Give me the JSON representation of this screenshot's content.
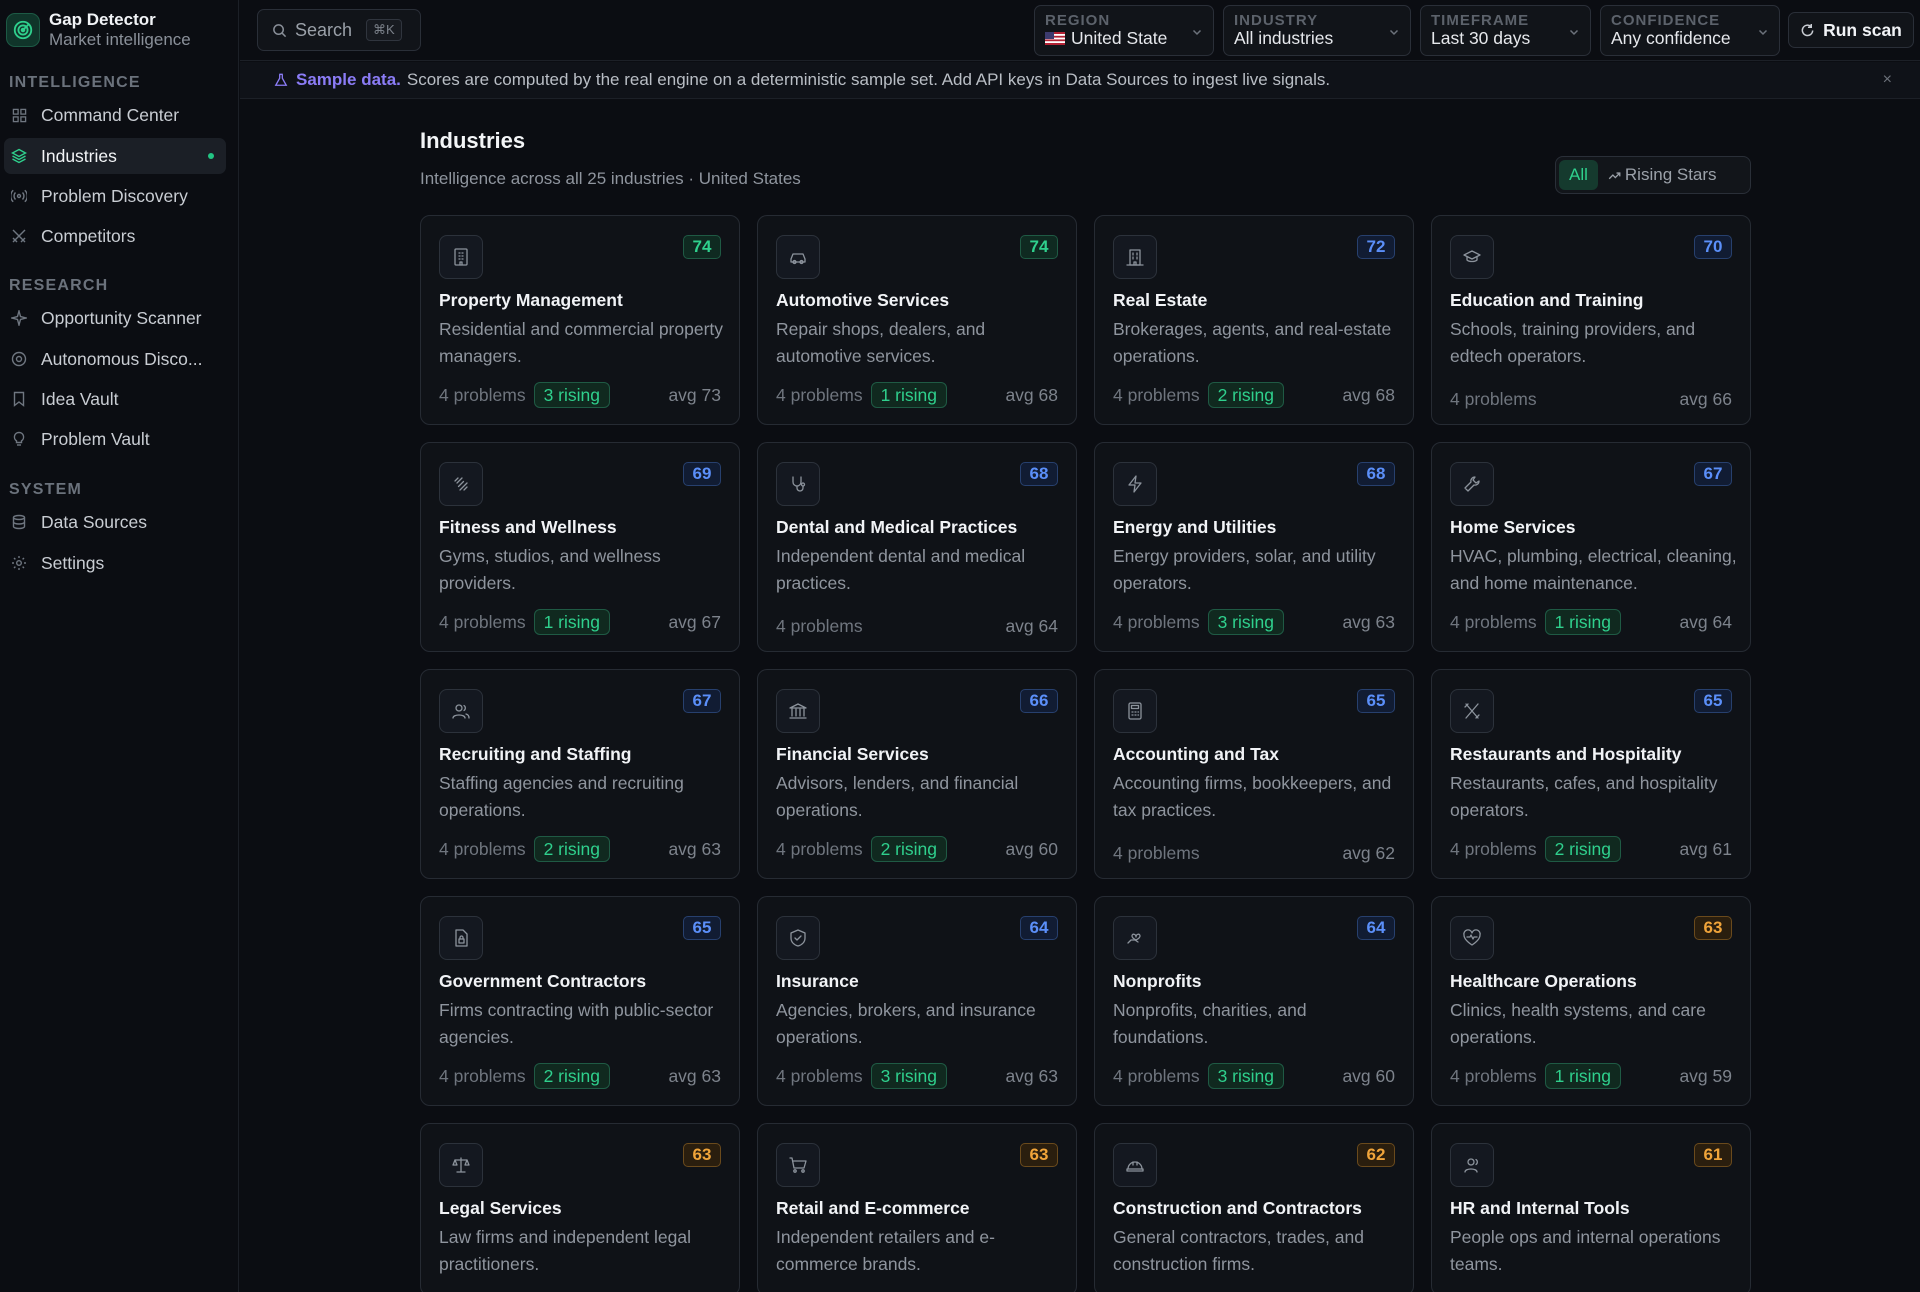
{
  "brand": {
    "title": "Gap Detector",
    "subtitle": "Market intelligence"
  },
  "sidebar": {
    "sections": [
      {
        "label": "INTELLIGENCE"
      },
      {
        "label": "RESEARCH"
      },
      {
        "label": "SYSTEM"
      }
    ],
    "items": [
      {
        "label": "Command Center",
        "icon": "grid-icon"
      },
      {
        "label": "Industries",
        "icon": "layers-icon",
        "active": true
      },
      {
        "label": "Problem Discovery",
        "icon": "radar-icon"
      },
      {
        "label": "Competitors",
        "icon": "crossed-swords-icon"
      },
      {
        "label": "Opportunity Scanner",
        "icon": "sparkle-icon"
      },
      {
        "label": "Autonomous Disco...",
        "icon": "orbit-icon"
      },
      {
        "label": "Idea Vault",
        "icon": "bookmark-icon"
      },
      {
        "label": "Problem Vault",
        "icon": "lightbulb-icon"
      },
      {
        "label": "Data Sources",
        "icon": "database-icon"
      },
      {
        "label": "Settings",
        "icon": "gear-icon"
      }
    ]
  },
  "topbar": {
    "search_placeholder": "Search",
    "search_shortcut": "⌘K",
    "filters": [
      {
        "label": "REGION",
        "value": "United State"
      },
      {
        "label": "INDUSTRY",
        "value": "All industries"
      },
      {
        "label": "TIMEFRAME",
        "value": "Last 30 days"
      },
      {
        "label": "CONFIDENCE",
        "value": "Any confidence"
      }
    ],
    "run_label": "Run scan"
  },
  "banner": {
    "strong": "Sample data.",
    "text": "Scores are computed by the real engine on a deterministic sample set. Add API keys in Data Sources to ingest live signals.",
    "close": "×"
  },
  "main": {
    "title": "Industries",
    "subtitle": "Intelligence across all 25 industries · United States",
    "segments": [
      "All",
      "Rising Stars"
    ]
  },
  "colors": {
    "accent": "#2fd08d",
    "score_high": "#2fd08d",
    "score_mid": "#5b8ff9",
    "score_low": "#f0a43a",
    "sample_banner": "#8b7cf6"
  },
  "cards": [
    {
      "title": "Property Management",
      "desc": "Residential and commercial property managers.",
      "score": "74",
      "tone": "green",
      "problems": "4 problems",
      "rising": "3 rising",
      "avg": "avg 73",
      "icon": "building-icon"
    },
    {
      "title": "Automotive Services",
      "desc": "Repair shops, dealers, and automotive services.",
      "score": "74",
      "tone": "green",
      "problems": "4 problems",
      "rising": "1 rising",
      "avg": "avg 68",
      "icon": "car-icon"
    },
    {
      "title": "Real Estate",
      "desc": "Brokerages, agents, and real-estate operations.",
      "score": "72",
      "tone": "blue",
      "problems": "4 problems",
      "rising": "2 rising",
      "avg": "avg 68",
      "icon": "office-building-icon"
    },
    {
      "title": "Education and Training",
      "desc": "Schools, training providers, and edtech operators.",
      "score": "70",
      "tone": "blue",
      "problems": "4 problems",
      "rising": "",
      "avg": "avg 66",
      "icon": "graduation-cap-icon"
    },
    {
      "title": "Fitness and Wellness",
      "desc": "Gyms, studios, and wellness providers.",
      "score": "69",
      "tone": "blue",
      "problems": "4 problems",
      "rising": "1 rising",
      "avg": "avg 67",
      "icon": "dumbbell-icon"
    },
    {
      "title": "Dental and Medical Practices",
      "desc": "Independent dental and medical practices.",
      "score": "68",
      "tone": "blue",
      "problems": "4 problems",
      "rising": "",
      "avg": "avg 64",
      "icon": "stethoscope-icon"
    },
    {
      "title": "Energy and Utilities",
      "desc": "Energy providers, solar, and utility operators.",
      "score": "68",
      "tone": "blue",
      "problems": "4 problems",
      "rising": "3 rising",
      "avg": "avg 63",
      "icon": "lightning-icon"
    },
    {
      "title": "Home Services",
      "desc": "HVAC, plumbing, electrical, cleaning, and home maintenance.",
      "score": "67",
      "tone": "blue",
      "problems": "4 problems",
      "rising": "1 rising",
      "avg": "avg 64",
      "icon": "wrench-icon"
    },
    {
      "title": "Recruiting and Staffing",
      "desc": "Staffing agencies and recruiting operations.",
      "score": "67",
      "tone": "blue",
      "problems": "4 problems",
      "rising": "2 rising",
      "avg": "avg 63",
      "icon": "users-icon"
    },
    {
      "title": "Financial Services",
      "desc": "Advisors, lenders, and financial operations.",
      "score": "66",
      "tone": "blue",
      "problems": "4 problems",
      "rising": "2 rising",
      "avg": "avg 60",
      "icon": "bank-icon"
    },
    {
      "title": "Accounting and Tax",
      "desc": "Accounting firms, bookkeepers, and tax practices.",
      "score": "65",
      "tone": "blue",
      "problems": "4 problems",
      "rising": "",
      "avg": "avg 62",
      "icon": "calculator-icon"
    },
    {
      "title": "Restaurants and Hospitality",
      "desc": "Restaurants, cafes, and hospitality operators.",
      "score": "65",
      "tone": "blue",
      "problems": "4 problems",
      "rising": "2 rising",
      "avg": "avg 61",
      "icon": "utensils-icon"
    },
    {
      "title": "Government Contractors",
      "desc": "Firms contracting with public-sector agencies.",
      "score": "65",
      "tone": "blue",
      "problems": "4 problems",
      "rising": "2 rising",
      "avg": "avg 63",
      "icon": "document-lock-icon"
    },
    {
      "title": "Insurance",
      "desc": "Agencies, brokers, and insurance operations.",
      "score": "64",
      "tone": "blue",
      "problems": "4 problems",
      "rising": "3 rising",
      "avg": "avg 63",
      "icon": "shield-icon"
    },
    {
      "title": "Nonprofits",
      "desc": "Nonprofits, charities, and foundations.",
      "score": "64",
      "tone": "blue",
      "problems": "4 problems",
      "rising": "3 rising",
      "avg": "avg 60",
      "icon": "hand-heart-icon"
    },
    {
      "title": "Healthcare Operations",
      "desc": "Clinics, health systems, and care operations.",
      "score": "63",
      "tone": "amber",
      "problems": "4 problems",
      "rising": "1 rising",
      "avg": "avg 59",
      "icon": "heart-pulse-icon"
    },
    {
      "title": "Legal Services",
      "desc": "Law firms and independent legal practitioners.",
      "score": "63",
      "tone": "amber",
      "problems": "",
      "rising": "",
      "avg": "",
      "icon": "scales-icon"
    },
    {
      "title": "Retail and E-commerce",
      "desc": "Independent retailers and e-commerce brands.",
      "score": "63",
      "tone": "amber",
      "problems": "",
      "rising": "",
      "avg": "",
      "icon": "cart-icon"
    },
    {
      "title": "Construction and Contractors",
      "desc": "General contractors, trades, and construction firms.",
      "score": "62",
      "tone": "amber",
      "problems": "",
      "rising": "",
      "avg": "",
      "icon": "hard-hat-icon"
    },
    {
      "title": "HR and Internal Tools",
      "desc": "People ops and internal operations teams.",
      "score": "61",
      "tone": "amber",
      "problems": "",
      "rising": "",
      "avg": "",
      "icon": "user-group-icon"
    }
  ]
}
